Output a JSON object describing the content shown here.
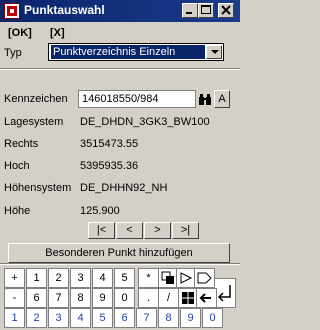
{
  "window": {
    "title": "Punktauswahl"
  },
  "menu": {
    "ok": "[OK]",
    "cancel": "[X]"
  },
  "typ": {
    "label": "Typ",
    "selected": "Punktverzeichnis Einzeln"
  },
  "fields": {
    "kennzeichen": {
      "label": "Kennzeichen",
      "value": "146018550/984"
    },
    "lagesystem": {
      "label": "Lagesystem",
      "value": "DE_DHDN_3GK3_BW100"
    },
    "rechts": {
      "label": "Rechts",
      "value": "3515473.55"
    },
    "hoch": {
      "label": "Hoch",
      "value": "5395935.36"
    },
    "hoehensystem": {
      "label": "Höhensystem",
      "value": "DE_DHHN92_NH"
    },
    "hoehe": {
      "label": "Höhe",
      "value": "125.900"
    }
  },
  "small_buttons": {
    "a": "A"
  },
  "nav": {
    "first": "|<",
    "prev": "<",
    "next": ">",
    "last": ">|"
  },
  "add_button": "Besonderen Punkt hinzufügen",
  "keypad": {
    "row1": [
      "+",
      "1",
      "2",
      "3",
      "4",
      "5",
      "*"
    ],
    "row2": [
      "-",
      "6",
      "7",
      "8",
      "9",
      "0",
      ".",
      "/"
    ],
    "row3": [
      "1",
      "2",
      "3",
      "4",
      "5",
      "6",
      "7",
      "8",
      "9",
      "0"
    ]
  }
}
